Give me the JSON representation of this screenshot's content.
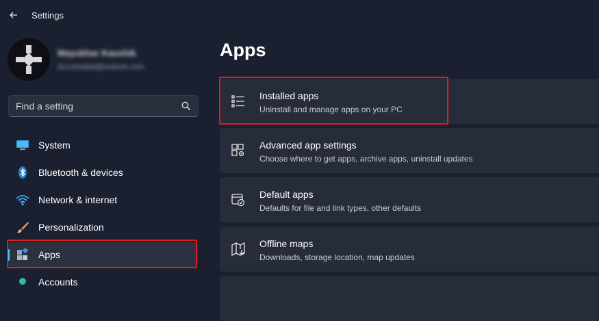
{
  "window": {
    "title": "Settings"
  },
  "account": {
    "name": "Mayukhar Kaushik",
    "email": "dcrushiabel@outlook.com"
  },
  "search": {
    "placeholder": "Find a setting"
  },
  "sidebar": {
    "items": [
      {
        "label": "System",
        "icon": "monitor-icon"
      },
      {
        "label": "Bluetooth & devices",
        "icon": "bluetooth-icon"
      },
      {
        "label": "Network & internet",
        "icon": "wifi-icon"
      },
      {
        "label": "Personalization",
        "icon": "brush-icon"
      },
      {
        "label": "Apps",
        "icon": "apps-icon",
        "selected": true
      },
      {
        "label": "Accounts",
        "icon": "person-icon"
      }
    ]
  },
  "main": {
    "title": "Apps",
    "cards": [
      {
        "title": "Installed apps",
        "subtitle": "Uninstall and manage apps on your PC",
        "icon": "list-icon"
      },
      {
        "title": "Advanced app settings",
        "subtitle": "Choose where to get apps, archive apps, uninstall updates",
        "icon": "app-settings-icon"
      },
      {
        "title": "Default apps",
        "subtitle": "Defaults for file and link types, other defaults",
        "icon": "default-apps-icon"
      },
      {
        "title": "Offline maps",
        "subtitle": "Downloads, storage location, map updates",
        "icon": "map-icon"
      }
    ]
  },
  "colors": {
    "accent": "#4cc2ff",
    "highlight": "#e01b1b",
    "background": "#1b2030",
    "card": "#272c3b"
  }
}
